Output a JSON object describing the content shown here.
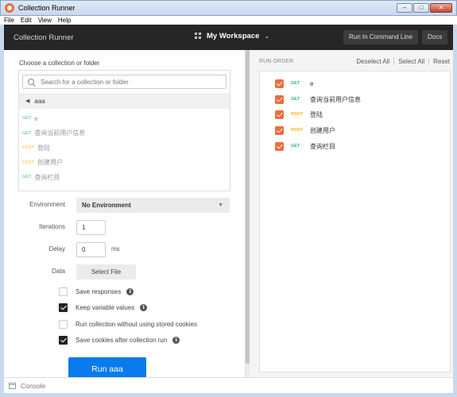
{
  "window": {
    "title": "Collection Runner",
    "controls": {
      "minimize": "‒",
      "maximize": "□",
      "close": "✕"
    }
  },
  "menu": [
    "File",
    "Edit",
    "View",
    "Help"
  ],
  "header": {
    "app_name": "Collection Runner",
    "workspace": "My Workspace",
    "run_cli_label": "Run In Command Line",
    "docs_label": "Docs"
  },
  "collection": {
    "choose_label": "Choose a collection or folder",
    "search_placeholder": "Search for a collection or folder",
    "folder_name": "aaa",
    "requests": [
      {
        "method": "GET",
        "name": "e"
      },
      {
        "method": "GET",
        "name": "查询当前用户信息"
      },
      {
        "method": "POST",
        "name": "登陆"
      },
      {
        "method": "POST",
        "name": "创建用户"
      },
      {
        "method": "GET",
        "name": "查询栏目"
      }
    ]
  },
  "form": {
    "environment_label": "Environment",
    "environment_value": "No Environment",
    "iterations_label": "Iterations",
    "iterations_value": "1",
    "delay_label": "Delay",
    "delay_value": "0",
    "delay_unit": "ms",
    "data_label": "Data",
    "select_file_label": "Select File"
  },
  "options": [
    {
      "label": "Save responses",
      "checked": false,
      "info": true
    },
    {
      "label": "Keep variable values",
      "checked": true,
      "info": true
    },
    {
      "label": "Run collection without using stored cookies",
      "checked": false,
      "info": false
    },
    {
      "label": "Save cookies after collection run",
      "checked": true,
      "info": true
    }
  ],
  "run_button": "Run aaa",
  "run_order": {
    "title": "RUN ORDER",
    "deselect_all": "Deselect All",
    "select_all": "Select All",
    "reset": "Reset",
    "items": [
      {
        "method": "GET",
        "name": "e",
        "checked": true
      },
      {
        "method": "GET",
        "name": "查询当前用户信息",
        "checked": true
      },
      {
        "method": "POST",
        "name": "登陆",
        "checked": true
      },
      {
        "method": "POST",
        "name": "创建用户",
        "checked": true
      },
      {
        "method": "GET",
        "name": "查询栏目",
        "checked": true
      }
    ]
  },
  "statusbar": {
    "console_label": "Console"
  },
  "colors": {
    "accent_orange": "#f26b3a",
    "run_blue": "#097bed",
    "get_green": "#26b47f",
    "post_yellow": "#ffb400",
    "header_dark": "#262626"
  },
  "icons": {
    "app": "postman-logo-icon",
    "workspace": "grid-icon",
    "search": "search-icon",
    "back": "caret-left-icon",
    "info": "info-icon",
    "console": "console-icon"
  }
}
